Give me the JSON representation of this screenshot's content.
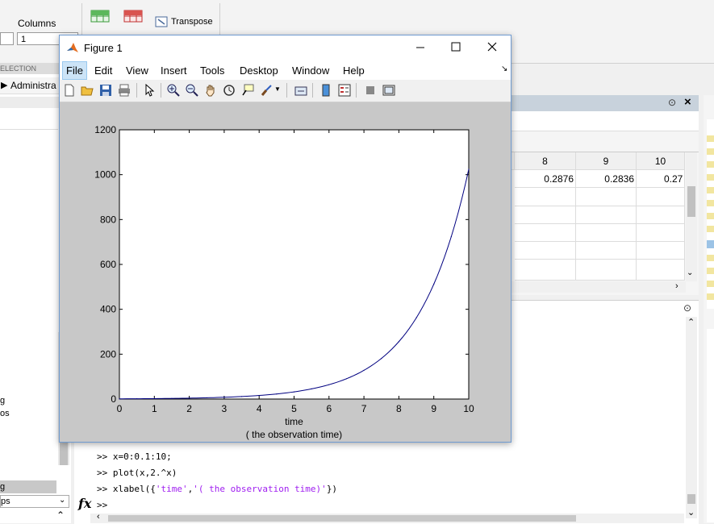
{
  "toolstrip": {
    "columns_label": "Columns",
    "columns_value": "1",
    "transpose_label": "Transpose",
    "section_label": "ELECTION"
  },
  "left_panel": {
    "folder_label": "Administra",
    "item_g": "g",
    "item_os": "os",
    "item_g2": "g",
    "item_ps": "ps"
  },
  "variables": {
    "headers": [
      "8",
      "9",
      "10"
    ],
    "row1": [
      "0.2876",
      "0.2836",
      "0.27"
    ]
  },
  "command_window": {
    "lines": [
      {
        "prompt": ">>",
        "code": "x=0:0.1:10;"
      },
      {
        "prompt": ">>",
        "code": "plot(x,2.^x)"
      }
    ],
    "xlabel_prefix": "xlabel({",
    "xlabel_str1": "'time'",
    "xlabel_comma": ",",
    "xlabel_str2": "'( the observation time)'",
    "xlabel_suffix": "})",
    "fx_label": "fx",
    "prompt": ">>"
  },
  "figure": {
    "title": "Figure 1",
    "menu": [
      "File",
      "Edit",
      "View",
      "Insert",
      "Tools",
      "Desktop",
      "Window",
      "Help"
    ],
    "active_menu": "File"
  },
  "colors": {
    "plot_line": "#000080",
    "string_literal": "#a020f0",
    "window_border": "#6f9bd1",
    "menu_highlight": "#cce4f7"
  },
  "chart_data": {
    "type": "line",
    "x": [
      0,
      0.5,
      1,
      1.5,
      2,
      2.5,
      3,
      3.5,
      4,
      4.5,
      5,
      5.5,
      6,
      6.5,
      7,
      7.5,
      8,
      8.5,
      9,
      9.5,
      10
    ],
    "series": [
      {
        "values": [
          1,
          1.414,
          2,
          2.828,
          4,
          5.657,
          8,
          11.314,
          16,
          22.627,
          32,
          45.255,
          64,
          90.51,
          128,
          181.02,
          256,
          362.04,
          512,
          724.08,
          1024
        ]
      }
    ],
    "xlim": [
      0,
      10
    ],
    "ylim": [
      0,
      1200
    ],
    "xticks": [
      "0",
      "1",
      "2",
      "3",
      "4",
      "5",
      "6",
      "7",
      "8",
      "9",
      "10"
    ],
    "yticks": [
      "0",
      "200",
      "400",
      "600",
      "800",
      "1000",
      "1200"
    ],
    "xlabel_line1": "time",
    "xlabel_line2": "( the observation time)",
    "grid": false
  }
}
